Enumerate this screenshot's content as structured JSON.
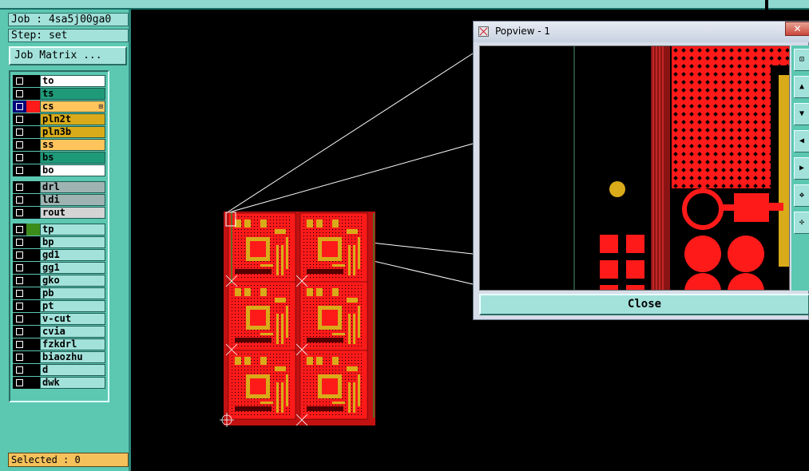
{
  "job": {
    "line": "Job : 4sa5j00ga0",
    "step": "Step: set"
  },
  "buttons": {
    "job_matrix": "Job Matrix ...",
    "close": "Close"
  },
  "selected": "Selected : 0",
  "layers": [
    {
      "name": "to",
      "color": "#ffffff",
      "swatch": "#000000"
    },
    {
      "name": "ts",
      "color": "#1f9a78",
      "swatch": "#000000"
    },
    {
      "name": "cs",
      "color": "#ffc45c",
      "swatch": "#ff1a1a",
      "active": true,
      "mark": "⊞"
    },
    {
      "name": "pln2t",
      "color": "#d9ab1a",
      "swatch": "#000000"
    },
    {
      "name": "pln3b",
      "color": "#d9ab1a",
      "swatch": "#000000"
    },
    {
      "name": "ss",
      "color": "#ffc45c",
      "swatch": "#000000"
    },
    {
      "name": "bs",
      "color": "#1f9a78",
      "swatch": "#000000"
    },
    {
      "name": "bo",
      "color": "#ffffff",
      "swatch": "#000000"
    },
    {
      "name": "drl",
      "color": "#9fb4b2",
      "swatch": "#000000"
    },
    {
      "name": "ldi",
      "color": "#9fb4b2",
      "swatch": "#000000"
    },
    {
      "name": "rout",
      "color": "#d4d4d4",
      "swatch": "#000000"
    },
    {
      "name": "tp",
      "color": "#a2e2da",
      "swatch": "#3c8c1c"
    },
    {
      "name": "bp",
      "color": "#a2e2da",
      "swatch": "#000000"
    },
    {
      "name": "gd1",
      "color": "#a2e2da",
      "swatch": "#000000"
    },
    {
      "name": "gg1",
      "color": "#a2e2da",
      "swatch": "#000000"
    },
    {
      "name": "gko",
      "color": "#a2e2da",
      "swatch": "#000000"
    },
    {
      "name": "pb",
      "color": "#a2e2da",
      "swatch": "#000000"
    },
    {
      "name": "pt",
      "color": "#a2e2da",
      "swatch": "#000000"
    },
    {
      "name": "v-cut",
      "color": "#a2e2da",
      "swatch": "#000000"
    },
    {
      "name": "cvia",
      "color": "#a2e2da",
      "swatch": "#000000"
    },
    {
      "name": "fzkdrl",
      "color": "#a2e2da",
      "swatch": "#000000"
    },
    {
      "name": "biaozhu",
      "color": "#a2e2da",
      "swatch": "#000000"
    },
    {
      "name": "d",
      "color": "#a2e2da",
      "swatch": "#000000"
    },
    {
      "name": "dwk",
      "color": "#a2e2da",
      "swatch": "#000000"
    }
  ],
  "popview": {
    "title": "Popview - 1",
    "close_x": "✕",
    "toolbar_icons": [
      "zoom-fit-icon",
      "pan-up-icon",
      "pan-down-icon",
      "pan-left-icon",
      "pan-right-icon",
      "zoom-in-icon",
      "zoom-out-icon"
    ],
    "toolbar_glyphs": [
      "⊡",
      "▲",
      "▼",
      "◀",
      "▶",
      "✥",
      "✣"
    ]
  },
  "colors": {
    "panel": "#5cc8b2",
    "copper": "#ff1a1a",
    "pad": "#d9ab1a",
    "selected": "#f5c15b"
  }
}
